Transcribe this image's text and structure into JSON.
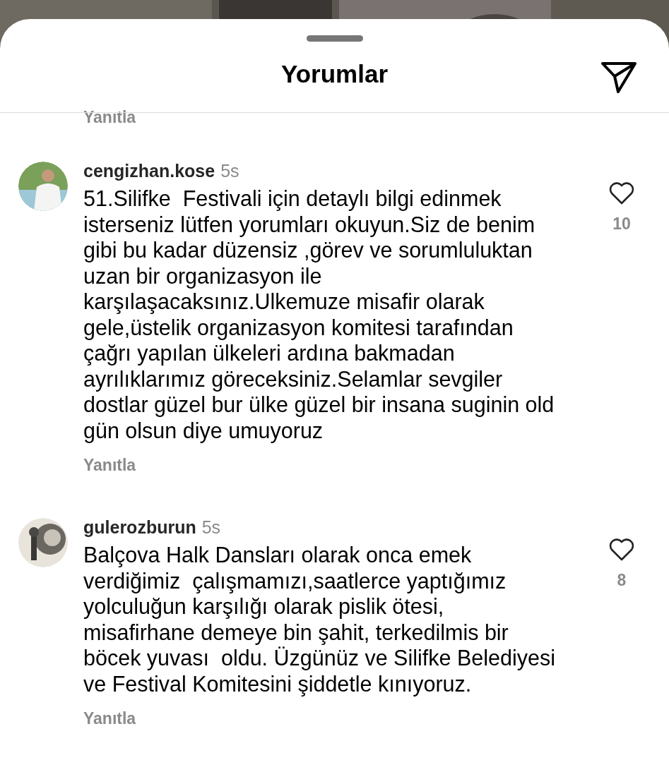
{
  "sheet": {
    "title": "Yorumlar",
    "previous_reply": "Yanıtla"
  },
  "comments": [
    {
      "username": "cengizhan.kose",
      "time": "5s",
      "text": "51.Silifke  Festivali için detaylı bilgi edinmek\nisterseniz lütfen yorumları okuyun.Siz de benim\ngibi bu kadar düzensiz ,görev ve sorumluluktan\nuzan bir organizasyon ile\nkarşılaşacaksınız.Ulkemuze misafir olarak\ngele,üstelik organizasyon komitesi tarafından\nçağrı yapılan ülkeleri ardına bakmadan\nayrılıklarımız göreceksiniz.Selamlar sevgiler\ndostlar güzel bur ülke güzel bir insana suginin old\ngün olsun diye umuyoruz",
      "likes": "10",
      "reply": "Yanıtla"
    },
    {
      "username": "gulerozburun",
      "time": "5s",
      "text": "Balçova Halk Dansları olarak onca emek\nverdiğimiz  çalışmamızı,saatlerce yaptığımız\nyolculuğun karşılığı olarak pislik ötesi,\nmisafirhane demeye bin şahit, terkedilmis bir\nböcek yuvası  oldu. Üzgünüz ve Silifke Belediyesi\nve Festival Komitesini şiddetle kınıyoruz.",
      "likes": "8",
      "reply": "Yanıtla"
    }
  ]
}
